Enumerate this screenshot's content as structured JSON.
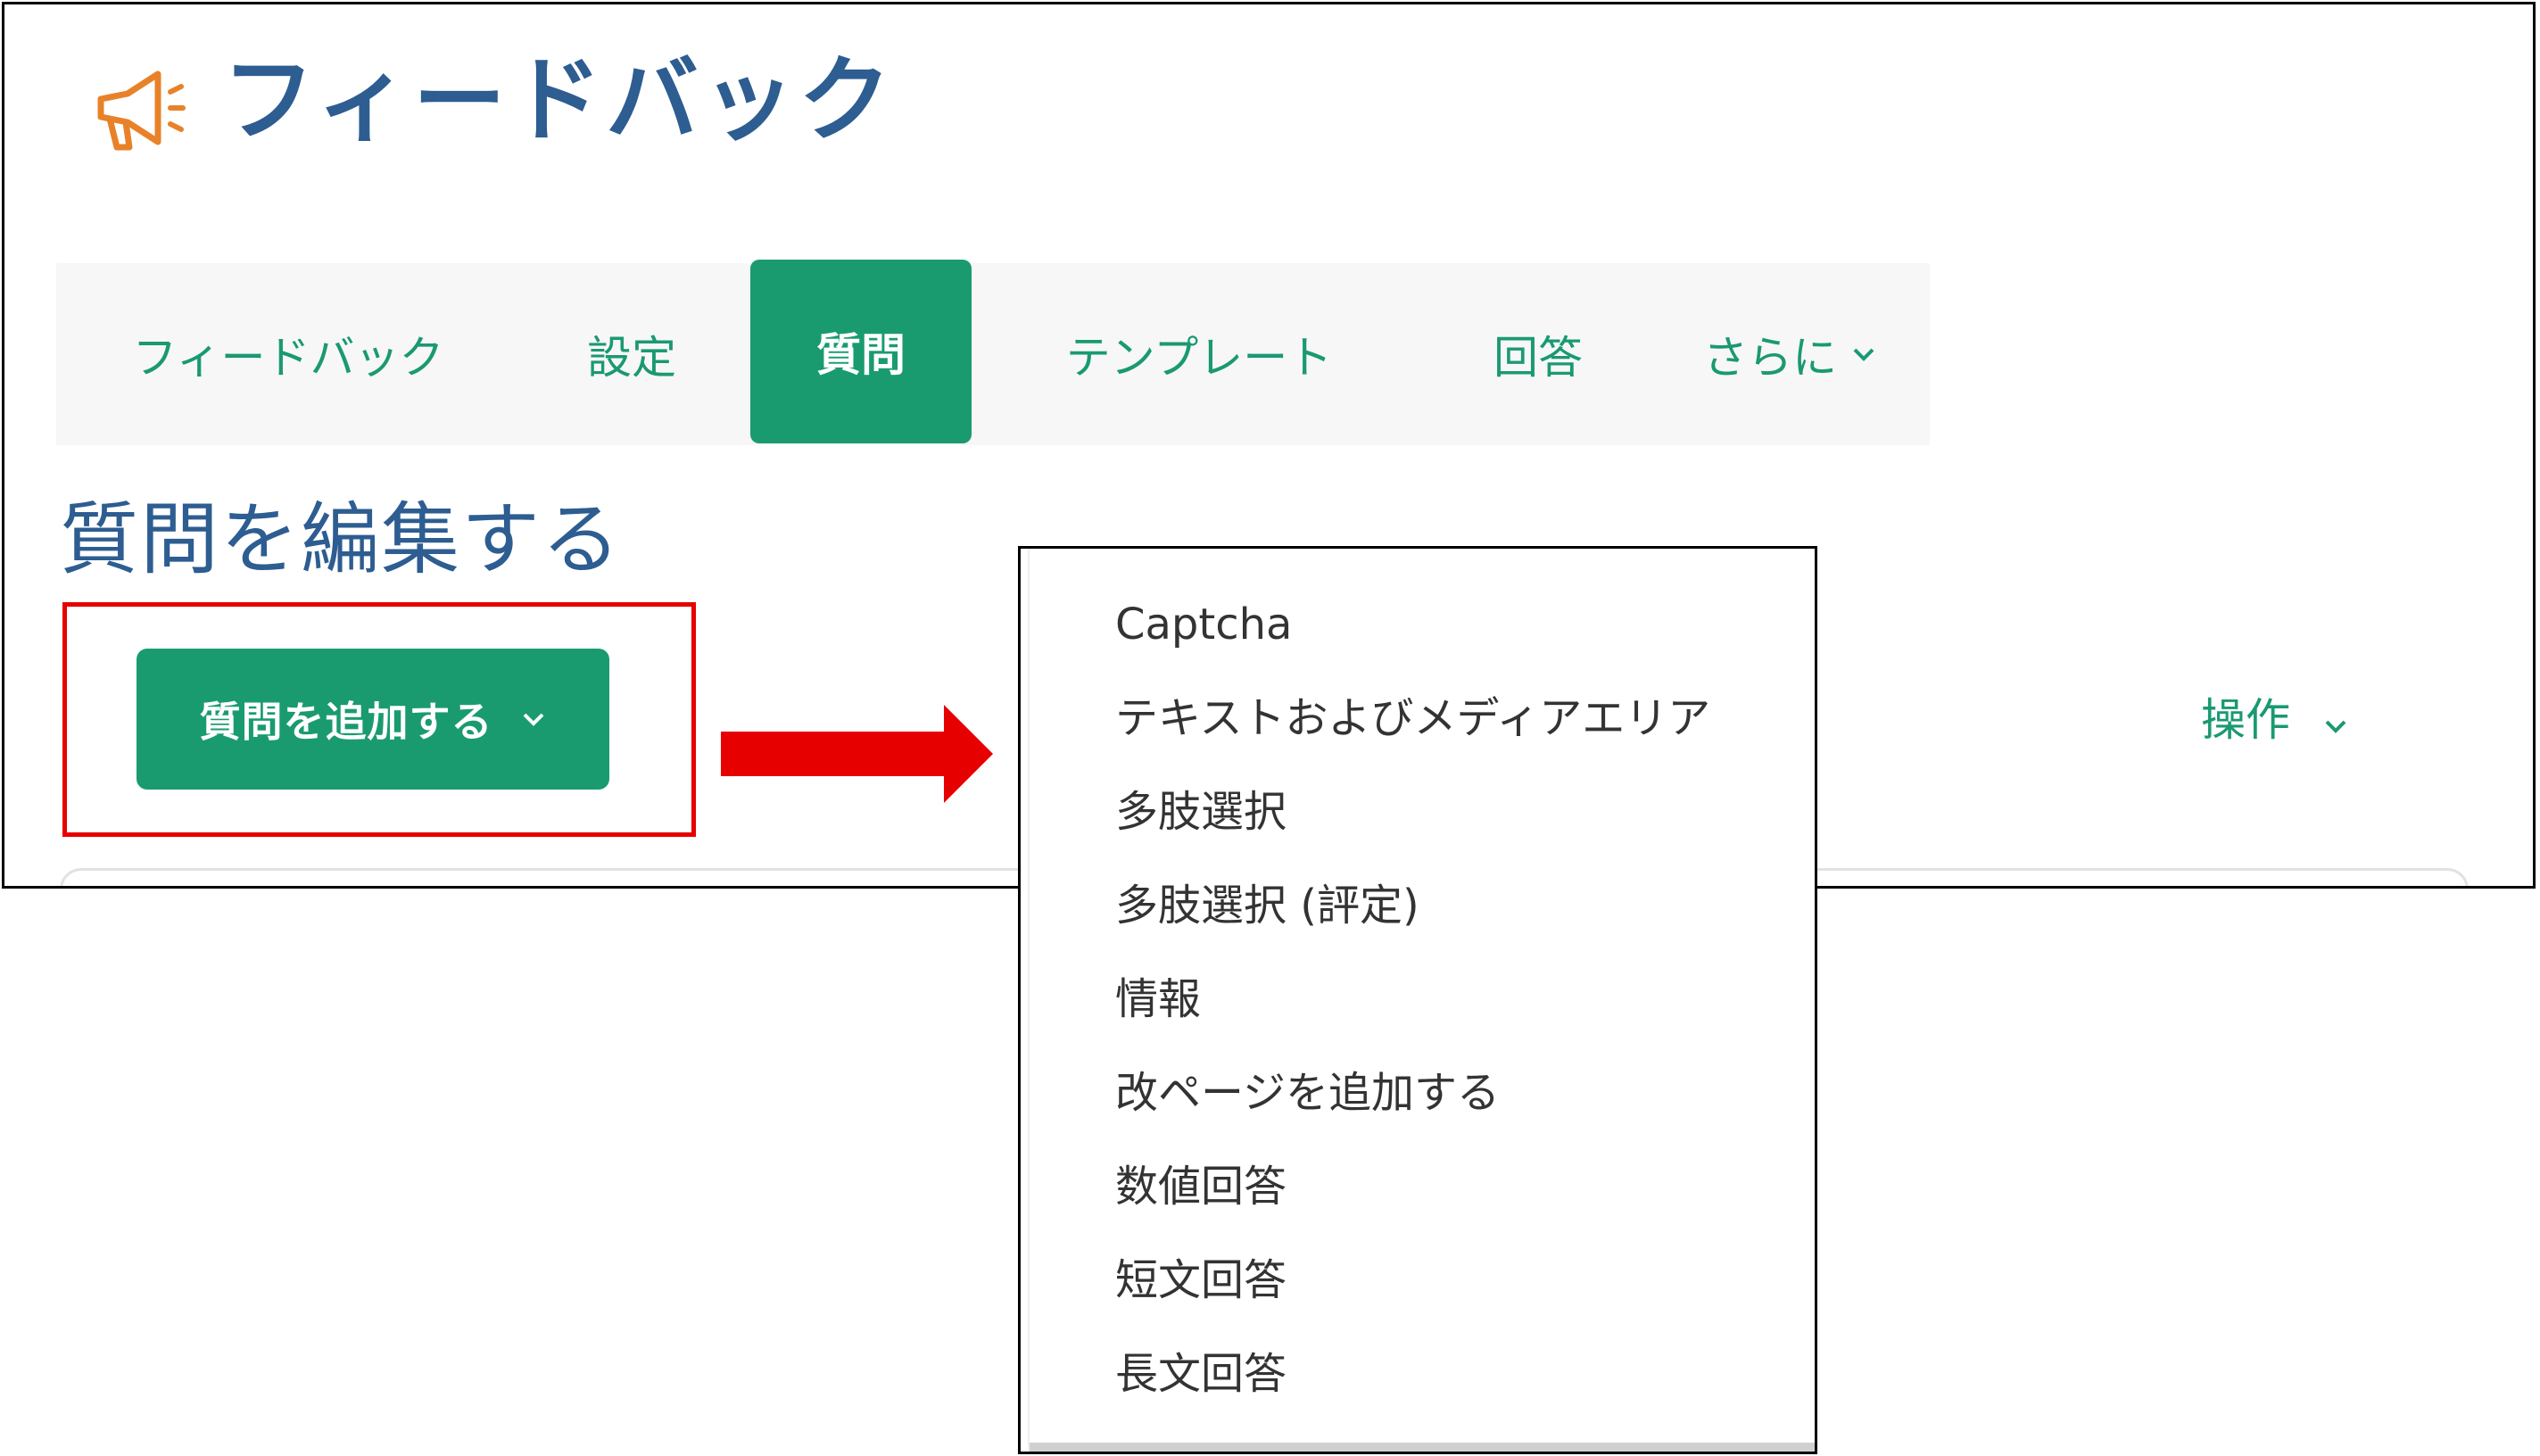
{
  "header": {
    "title": "フィードバック",
    "icon": "megaphone-icon"
  },
  "tabs": [
    {
      "label": "フィードバック",
      "active": false
    },
    {
      "label": "設定",
      "active": false
    },
    {
      "label": "質問",
      "active": true
    },
    {
      "label": "テンプレート",
      "active": false
    },
    {
      "label": "回答",
      "active": false
    },
    {
      "label": "さらに",
      "active": false,
      "icon": "chevron-down-icon"
    }
  ],
  "main": {
    "heading": "質問を編集する",
    "add_question_label": "質問を追加する",
    "operations_label": "操作"
  },
  "dropdown": {
    "items": [
      "Captcha",
      "テキストおよびメディアエリア",
      "多肢選択",
      "多肢選択 (評定)",
      "情報",
      "改ページを追加する",
      "数値回答",
      "短文回答",
      "長文回答"
    ]
  },
  "colors": {
    "accent_green": "#1a9b6f",
    "title_blue": "#2d5d91",
    "icon_orange": "#e8822a",
    "highlight_red": "#e60000"
  }
}
